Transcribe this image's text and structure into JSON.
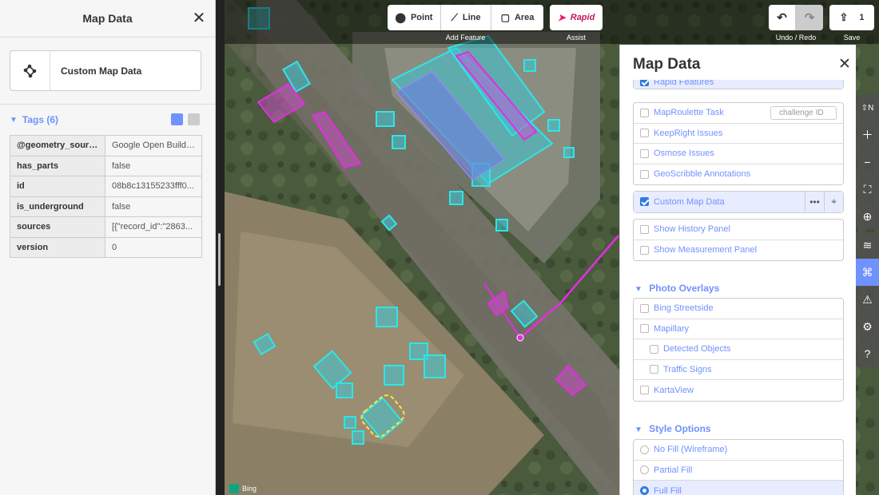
{
  "sidebar": {
    "title": "Map Data",
    "preset_label": "Custom Map Data",
    "tags_title": "Tags (6)",
    "tags": [
      {
        "key": "@geometry_source",
        "value": "Google Open Buildi..."
      },
      {
        "key": "has_parts",
        "value": "false"
      },
      {
        "key": "id",
        "value": "08b8c13155233fff0..."
      },
      {
        "key": "is_underground",
        "value": "false"
      },
      {
        "key": "sources",
        "value": "[{\"record_id\":\"2863..."
      },
      {
        "key": "version",
        "value": "0"
      }
    ]
  },
  "toolbar": {
    "point": "Point",
    "line": "Line",
    "area": "Area",
    "add_feature": "Add Feature",
    "rapid": "Rapid",
    "assist": "Assist",
    "undo_redo": "Undo / Redo",
    "save_count": "1",
    "save": "Save"
  },
  "pane": {
    "title": "Map Data",
    "rapid_features": "Rapid Features",
    "data_layers": [
      {
        "label": "MapRoulette Task",
        "checked": false
      },
      {
        "label": "KeepRight Issues",
        "checked": false
      },
      {
        "label": "Osmose Issues",
        "checked": false
      },
      {
        "label": "GeoScribble Annotations",
        "checked": false
      }
    ],
    "challenge_placeholder": "challenge ID",
    "custom_map_data": "Custom Map Data",
    "panels": [
      "Show History Panel",
      "Show Measurement Panel"
    ],
    "photo_overlays_title": "Photo Overlays",
    "photo_overlays": [
      {
        "label": "Bing Streetside",
        "sub": false
      },
      {
        "label": "Mapillary",
        "sub": false
      },
      {
        "label": "Detected Objects",
        "sub": true
      },
      {
        "label": "Traffic Signs",
        "sub": true
      },
      {
        "label": "KartaView",
        "sub": false
      }
    ],
    "style_options_title": "Style Options",
    "style_options": [
      {
        "label": "No Fill (Wireframe)",
        "selected": false
      },
      {
        "label": "Partial Fill",
        "selected": false
      },
      {
        "label": "Full Fill",
        "selected": true
      }
    ]
  },
  "map": {
    "attribution": "Bing"
  },
  "colors": {
    "accent": "#7092ff",
    "building_cyan": "#2ee6e6",
    "feature_magenta": "#e22ee2",
    "selection_yellow": "#ffe14d"
  }
}
